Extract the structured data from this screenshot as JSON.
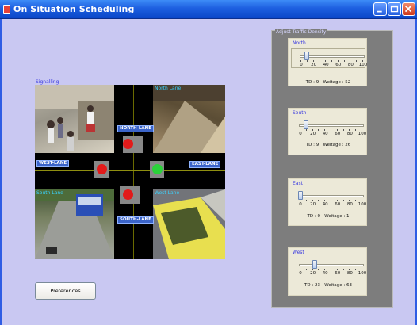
{
  "window": {
    "title": "On Situation Scheduling",
    "controls": [
      "minimize-icon",
      "maximize-icon",
      "close-icon"
    ]
  },
  "signalling": {
    "label": "Signalling",
    "camera_labels": {
      "north": "North Lane",
      "south": "South Lane",
      "west": "West Lane"
    },
    "lane_labels": {
      "north": "NORTH-LANE",
      "south": "SOUTH-LANE",
      "west": "WEST-LANE",
      "east": "EAST-LANE"
    },
    "signals": {
      "north": "red",
      "south": "red",
      "west": "red",
      "east": "green"
    },
    "colors": {
      "red": "#e21a1a",
      "green": "#2bd33a"
    }
  },
  "preferences": {
    "label": "Preferences"
  },
  "density": {
    "title": "Adjust Traffic Density",
    "scale": [
      "0",
      "20",
      "40",
      "60",
      "80",
      "100"
    ],
    "directions": [
      {
        "label": "North",
        "td": "TD : 9",
        "weightage": "Weitage :  52",
        "value": 9
      },
      {
        "label": "South",
        "td": "TD : 9",
        "weightage": "Weitage :  26",
        "value": 9
      },
      {
        "label": "East",
        "td": "TD : 0",
        "weightage": "Weitage :  1",
        "value": 0
      },
      {
        "label": "West",
        "td": "TD : 23",
        "weightage": "Weitage :  63",
        "value": 23
      }
    ]
  }
}
